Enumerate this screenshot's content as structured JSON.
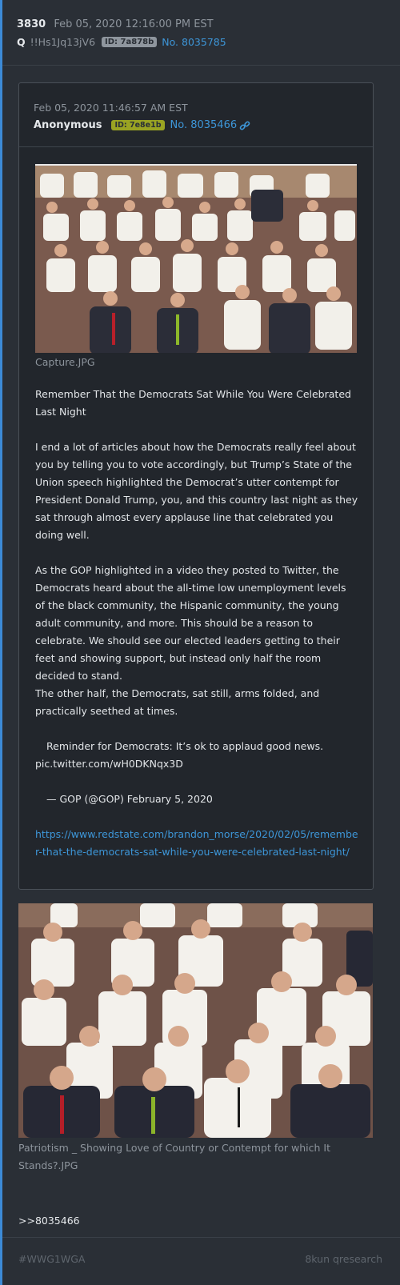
{
  "post": {
    "number": "3830",
    "date": "Feb 05, 2020 12:16:00 PM EST",
    "q_label": "Q",
    "tripcode": "!!Hs1Jq13jV6",
    "id_badge": "ID: 7a878b",
    "post_link": "No. 8035785"
  },
  "quoted_post": {
    "date": "Feb 05, 2020 11:46:57 AM EST",
    "name": "Anonymous",
    "id_badge": "ID: 7e8e1b",
    "post_link": "No. 8035466",
    "image_caption": "Capture.JPG",
    "title_text": "Remember That the Democrats Sat While You Were Celebrated Last Night",
    "paragraph_1": "I end a lot of articles about how the Democrats really feel about you by telling you to vote accordingly, but Trump’s State of the Union speech highlighted the Democrat’s utter contempt for President Donald Trump, you, and this country last night as they sat through almost every applause line that celebrated you doing well.",
    "paragraph_2": "As the GOP highlighted in a video they posted to Twitter, the Democrats heard about the all-time low unemployment levels of the black community, the Hispanic community, the young adult community, and more. This should be a reason to celebrate. We should see our elected leaders getting to their feet and showing support, but instead only half the room decided to stand.",
    "paragraph_3": "The other half, the Democrats, sat still, arms folded, and practically seethed at times.",
    "tweet_line": "Reminder for Democrats: It’s ok to applaud good news.",
    "tweet_link": "pic.twitter.com/wH0DKNqx3D",
    "tweet_attribution": "— GOP (@GOP) February 5, 2020",
    "article_url": "https://www.redstate.com/brandon_morse/2020/02/05/remember-that-the-democrats-sat-while-you-were-celebrated-last-night/"
  },
  "attachment": {
    "caption": "Patriotism _ Showing Love of Country or Contempt for which It Stands?.JPG"
  },
  "reply_ref": ">>8035466",
  "footer": {
    "hashtag": "#WWG1WGA",
    "board": "8kun qresearch"
  },
  "colors": {
    "background": "#2a2f36",
    "link": "#3d96d8",
    "accent_bar": "#3c8ad6"
  },
  "icons": [
    "link-icon"
  ]
}
